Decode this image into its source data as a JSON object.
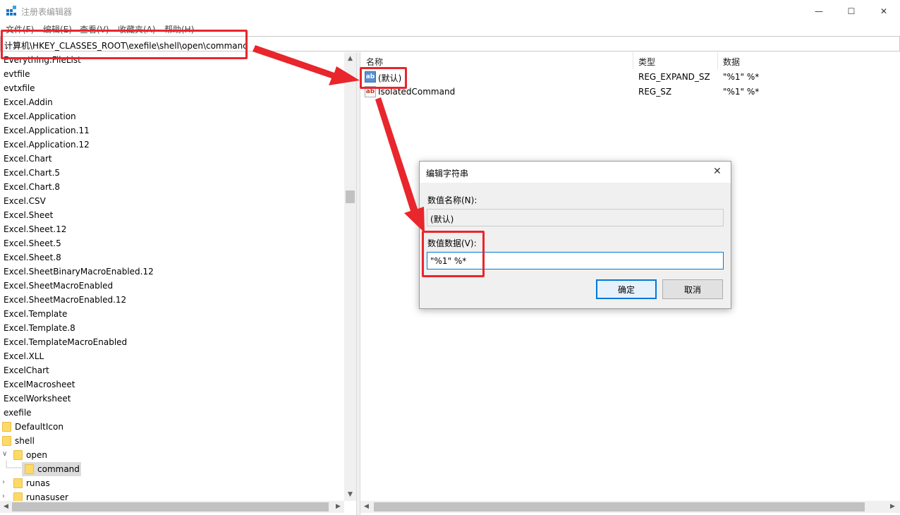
{
  "window": {
    "title": "注册表编辑器",
    "minimize_glyph": "—",
    "maximize_glyph": "☐",
    "close_glyph": "✕"
  },
  "menu": [
    "文件(F)",
    "编辑(E)",
    "查看(V)",
    "收藏夹(A)",
    "帮助(H)"
  ],
  "address": "计算机\\HKEY_CLASSES_ROOT\\exefile\\shell\\open\\command",
  "tree": {
    "items": [
      {
        "label": "Everything.FileList"
      },
      {
        "label": "evtfile"
      },
      {
        "label": "evtxfile"
      },
      {
        "label": "Excel.Addin"
      },
      {
        "label": "Excel.Application"
      },
      {
        "label": "Excel.Application.11"
      },
      {
        "label": "Excel.Application.12"
      },
      {
        "label": "Excel.Chart"
      },
      {
        "label": "Excel.Chart.5"
      },
      {
        "label": "Excel.Chart.8"
      },
      {
        "label": "Excel.CSV"
      },
      {
        "label": "Excel.Sheet"
      },
      {
        "label": "Excel.Sheet.12"
      },
      {
        "label": "Excel.Sheet.5"
      },
      {
        "label": "Excel.Sheet.8"
      },
      {
        "label": "Excel.SheetBinaryMacroEnabled.12"
      },
      {
        "label": "Excel.SheetMacroEnabled"
      },
      {
        "label": "Excel.SheetMacroEnabled.12"
      },
      {
        "label": "Excel.Template"
      },
      {
        "label": "Excel.Template.8"
      },
      {
        "label": "Excel.TemplateMacroEnabled"
      },
      {
        "label": "Excel.XLL"
      },
      {
        "label": "ExcelChart"
      },
      {
        "label": "ExcelMacrosheet"
      },
      {
        "label": "ExcelWorksheet"
      },
      {
        "label": "exefile"
      },
      {
        "label": "DefaultIcon"
      },
      {
        "label": "shell"
      },
      {
        "label": "open"
      },
      {
        "label": "command"
      },
      {
        "label": "runas"
      },
      {
        "label": "runasuser"
      }
    ]
  },
  "list": {
    "headers": {
      "name": "名称",
      "type": "类型",
      "data": "数据"
    },
    "rows": [
      {
        "icon": "ab",
        "name": "(默认)",
        "type": "REG_EXPAND_SZ",
        "data": "\"%1\" %*"
      },
      {
        "icon": "ab",
        "name": "IsolatedCommand",
        "type": "REG_SZ",
        "data": "\"%1\" %*"
      }
    ]
  },
  "dialog": {
    "title": "编辑字符串",
    "name_label": "数值名称(N):",
    "name_value": "(默认)",
    "data_label": "数值数据(V):",
    "data_value": "\"%1\" %*",
    "ok": "确定",
    "cancel": "取消"
  },
  "colors": {
    "annotation": "#e8262c",
    "focus": "#0078d7",
    "folder": "#ffd966"
  }
}
